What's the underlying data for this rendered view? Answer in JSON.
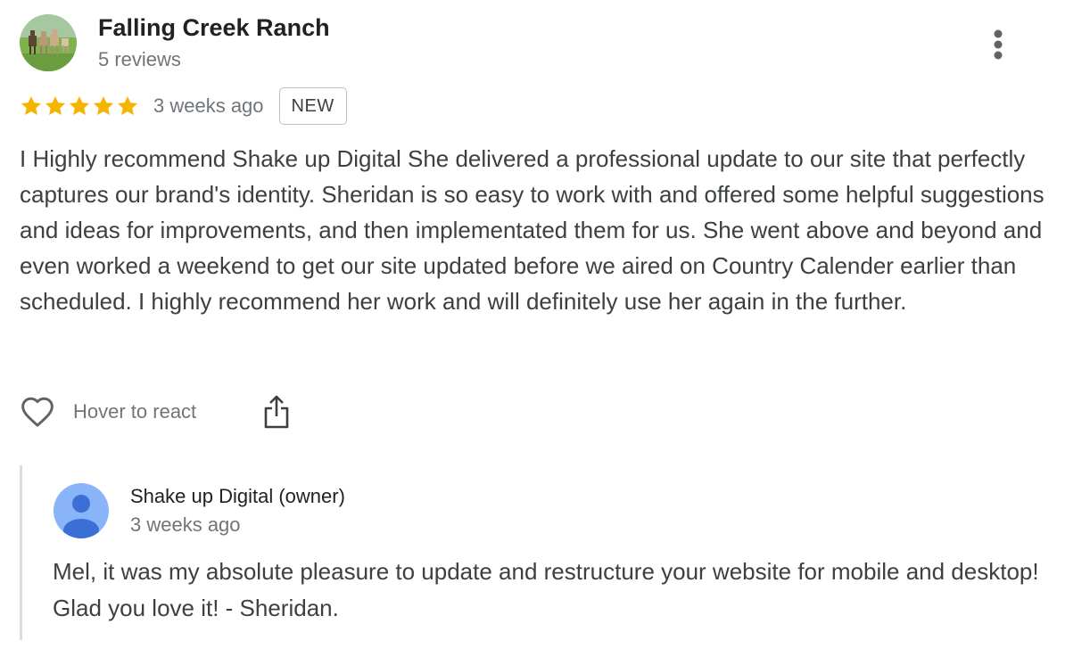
{
  "review": {
    "reviewer_name": "Falling Creek Ranch",
    "reviewer_meta": "5 reviews",
    "avatar_icon": "horses-photo-avatar",
    "rating": 5,
    "rating_max": 5,
    "star_color": "#f4b400",
    "date": "3 weeks ago",
    "badge": "NEW",
    "text": "I Highly recommend Shake up Digital She delivered a professional update to our site that perfectly captures our brand's identity. Sheridan is so easy to work with and offered some helpful suggestions and ideas for improvements, and then implementated them for us. She went above and beyond and even worked a weekend to get our site updated before we aired on Country Calender earlier than scheduled. I highly recommend her work and will definitely use her again in the further."
  },
  "actions": {
    "react_label": "Hover to react",
    "react_icon": "heart-outline-icon",
    "share_icon": "share-icon",
    "more_icon": "more-vert-icon"
  },
  "owner_response": {
    "name": "Shake up Digital (owner)",
    "date": "3 weeks ago",
    "avatar_icon": "default-person-avatar",
    "avatar_color": "#8ab4f8",
    "text": "Mel, it was my absolute pleasure to update and restructure your website for mobile and desktop! Glad you love it! - Sheridan."
  }
}
